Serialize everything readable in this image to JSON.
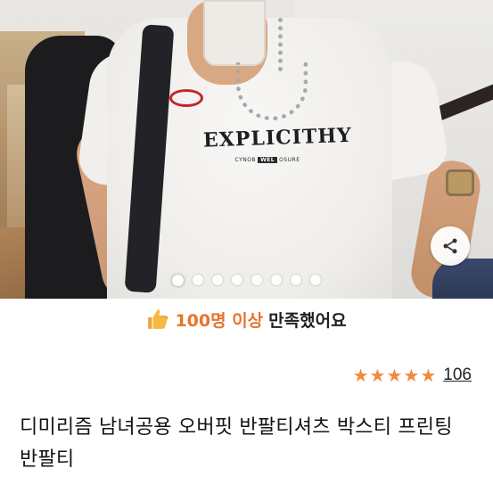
{
  "product_image": {
    "print_text": "EXPLICITHY",
    "print_subtext_left": "CYNOB",
    "print_subtext_mid": "WEL",
    "print_subtext_right": "OSURE",
    "share_icon": "share-icon",
    "carousel": {
      "total": 8,
      "active_index": 0
    }
  },
  "satisfaction": {
    "icon": "thumbs-up-icon",
    "count_text": "100명 이상",
    "suffix_text": "만족했어요",
    "accent_color": "#e8742a"
  },
  "rating": {
    "stars": 5,
    "star_color": "#f08a3c",
    "review_count": "106"
  },
  "product": {
    "title": "디미리즘 남녀공용 오버핏 반팔티셔츠 박스티 프린팅 반팔티"
  }
}
